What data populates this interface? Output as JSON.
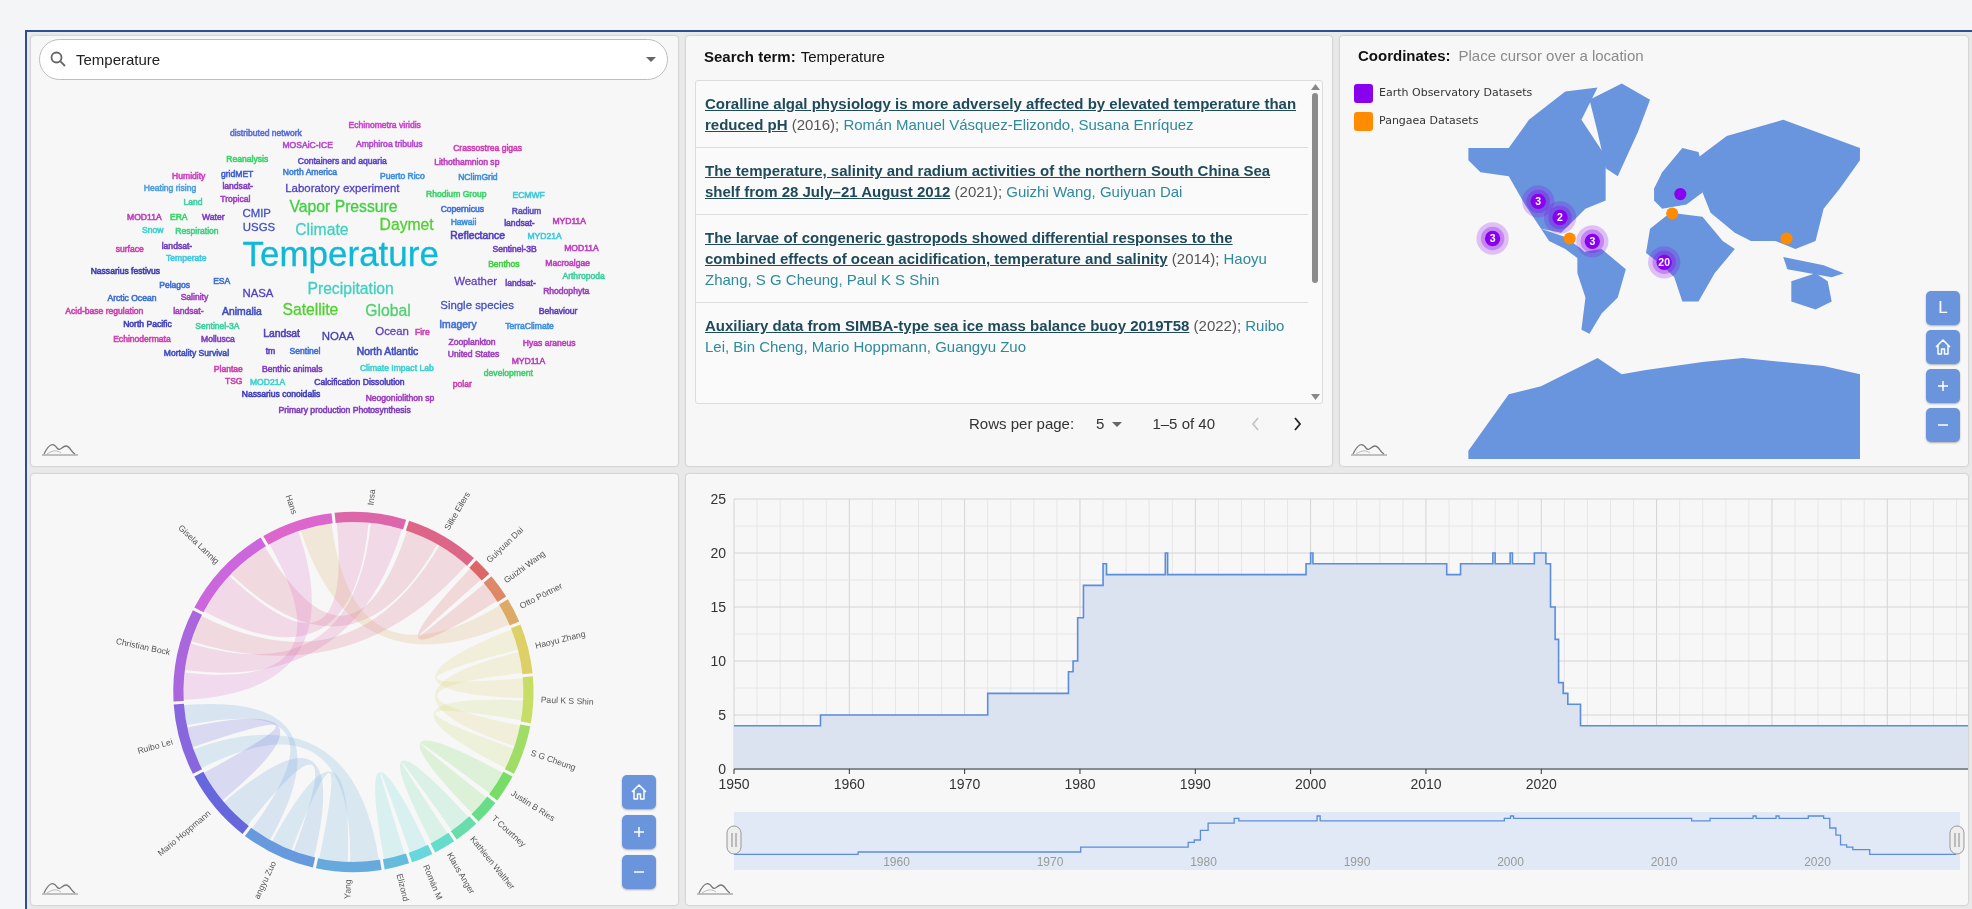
{
  "word_cloud_panel": {
    "search": {
      "value": "Temperature"
    },
    "words": [
      {
        "text": "Echinometra viridis",
        "color": "#cc44cc"
      },
      {
        "text": "distributed network",
        "color": "#5b6fd6"
      },
      {
        "text": "MOSAiC-ICE",
        "color": "#b44ad0"
      },
      {
        "text": "Amphiroa tribulus",
        "color": "#b44ad0"
      },
      {
        "text": "Crassostrea gigas",
        "color": "#d040b0"
      },
      {
        "text": "Reanalysis",
        "color": "#3bd36a"
      },
      {
        "text": "Containers and aquaria",
        "color": "#6048c8"
      },
      {
        "text": "Lithothamnion sp",
        "color": "#c040c0"
      },
      {
        "text": "Humidity",
        "color": "#d040c0"
      },
      {
        "text": "gridMET",
        "color": "#4060d0"
      },
      {
        "text": "North America",
        "color": "#3f7fd8"
      },
      {
        "text": "Puerto Rico",
        "color": "#3f8fe0"
      },
      {
        "text": "NClimGrid",
        "color": "#3f8fe0"
      },
      {
        "text": "Heating rising",
        "color": "#4f9fe0"
      },
      {
        "text": "landsat-",
        "color": "#8040c0"
      },
      {
        "text": "Laboratory experiment",
        "color": "#5040c0"
      },
      {
        "text": "Rhodium Group",
        "color": "#3bd36a"
      },
      {
        "text": "ECMWF",
        "color": "#40c8d8"
      },
      {
        "text": "Land",
        "color": "#40d0a0"
      },
      {
        "text": "Tropical",
        "color": "#a040c0"
      },
      {
        "text": "Vapor Pressure",
        "color": "#40d040"
      },
      {
        "text": "Copernicus",
        "color": "#4070d8"
      },
      {
        "text": "Radium",
        "color": "#6050c0"
      },
      {
        "text": "MOD11A",
        "color": "#c040c0"
      },
      {
        "text": "ERA",
        "color": "#3bd36a"
      },
      {
        "text": "Water",
        "color": "#8040c0"
      },
      {
        "text": "CMIP",
        "color": "#4050c0"
      },
      {
        "text": "Hawaii",
        "color": "#4090e0"
      },
      {
        "text": "landsat-",
        "color": "#6040c0"
      },
      {
        "text": "MYD11A",
        "color": "#c040c0"
      },
      {
        "text": "Snow",
        "color": "#40d0d0"
      },
      {
        "text": "Respiration",
        "color": "#40d080"
      },
      {
        "text": "USGS",
        "color": "#4050c0"
      },
      {
        "text": "Climate",
        "color": "#40d0c0"
      },
      {
        "text": "Daymet",
        "color": "#50d030"
      },
      {
        "text": "Reflectance",
        "color": "#5040c0"
      },
      {
        "text": "MYD21A",
        "color": "#40c8e0"
      },
      {
        "text": "surface",
        "color": "#d040b0"
      },
      {
        "text": "landsat-",
        "color": "#7040c0"
      },
      {
        "text": "Temperate",
        "color": "#40c8e0"
      },
      {
        "text": "Temperature",
        "color": "#10b8d8"
      },
      {
        "text": "Sentinel-3B",
        "color": "#7040c0"
      },
      {
        "text": "MOD11A",
        "color": "#c040c0"
      },
      {
        "text": "Benthos",
        "color": "#40d040"
      },
      {
        "text": "Macroalgae",
        "color": "#c040c0"
      },
      {
        "text": "Nassarius festivus",
        "color": "#4040b0"
      },
      {
        "text": "Arthropoda",
        "color": "#40d0a0"
      },
      {
        "text": "Arctic Ocean",
        "color": "#4070d0"
      },
      {
        "text": "Pelagos",
        "color": "#4070d8"
      },
      {
        "text": "Salinity",
        "color": "#a040c0"
      },
      {
        "text": "ESA",
        "color": "#4070d8"
      },
      {
        "text": "NASA",
        "color": "#5040c0"
      },
      {
        "text": "Precipitation",
        "color": "#40d0c0"
      },
      {
        "text": "Weather",
        "color": "#6040c0"
      },
      {
        "text": "landsat-",
        "color": "#7040c0"
      },
      {
        "text": "Rhodophyta",
        "color": "#a040c0"
      },
      {
        "text": "Acid-base regulation",
        "color": "#d040b0"
      },
      {
        "text": "landsat-",
        "color": "#a040c0"
      },
      {
        "text": "Animalia",
        "color": "#4050c0"
      },
      {
        "text": "Satellite",
        "color": "#50d030"
      },
      {
        "text": "Global",
        "color": "#50d070"
      },
      {
        "text": "Single species",
        "color": "#4050c0"
      },
      {
        "text": "Behaviour",
        "color": "#6040c0"
      },
      {
        "text": "North Pacific",
        "color": "#4040c0"
      },
      {
        "text": "Sentinel-3A",
        "color": "#40d0a0"
      },
      {
        "text": "Landsat",
        "color": "#5040c0"
      },
      {
        "text": "NOAA",
        "color": "#4040b0"
      },
      {
        "text": "Ocean",
        "color": "#6040c0"
      },
      {
        "text": "Fire",
        "color": "#d040b0"
      },
      {
        "text": "Imagery",
        "color": "#4070d8"
      },
      {
        "text": "TerraClimate",
        "color": "#4090e0"
      },
      {
        "text": "Echinodermata",
        "color": "#d040b0"
      },
      {
        "text": "Mollusca",
        "color": "#8040c0"
      },
      {
        "text": "Zooplankton",
        "color": "#a040c0"
      },
      {
        "text": "Hyas araneus",
        "color": "#c040c0"
      },
      {
        "text": "Mortality Survival",
        "color": "#4050c0"
      },
      {
        "text": "tm",
        "color": "#6040c0"
      },
      {
        "text": "Sentinel",
        "color": "#4070d8"
      },
      {
        "text": "North Atlantic",
        "color": "#4050c0"
      },
      {
        "text": "United States",
        "color": "#a040c0"
      },
      {
        "text": "MYD11A",
        "color": "#c040c0"
      },
      {
        "text": "Plantae",
        "color": "#d040b0"
      },
      {
        "text": "Benthic animals",
        "color": "#8040c0"
      },
      {
        "text": "Climate Impact Lab",
        "color": "#40d0d0"
      },
      {
        "text": "development",
        "color": "#40d070"
      },
      {
        "text": "TSG",
        "color": "#d040b0"
      },
      {
        "text": "MOD21A",
        "color": "#40d0d0"
      },
      {
        "text": "Calcification Dissolution",
        "color": "#5040c0"
      },
      {
        "text": "polar",
        "color": "#d040b0"
      },
      {
        "text": "Nassarius conoidalis",
        "color": "#4040c0"
      },
      {
        "text": "Neogoniolithon sp",
        "color": "#a040c0"
      },
      {
        "text": "Primary production Photosynthesis",
        "color": "#8040c0"
      }
    ]
  },
  "results_panel": {
    "label": "Search term:",
    "term": "Temperature",
    "results": [
      {
        "title": "Coralline algal physiology is more adversely affected by elevated temperature than reduced pH",
        "year": "(2016);",
        "authors": "Román Manuel Vásquez-Elizondo, Susana Enríquez"
      },
      {
        "title": "The temperature, salinity and radium activities of the northern South China Sea shelf from 28 July–21 August 2012",
        "year": "(2021);",
        "authors": "Guizhi Wang, Guiyuan Dai"
      },
      {
        "title": "The larvae of congeneric gastropods showed differential responses to the combined effects of ocean acidification, temperature and salinity",
        "year": "(2014);",
        "authors": "Haoyu Zhang, S G Cheung, Paul K S Shin"
      },
      {
        "title": "Auxiliary data from SIMBA-type sea ice mass balance buoy 2019T58",
        "year": "(2022);",
        "authors": "Ruibo Lei, Bin Cheng, Mario Hoppmann, Guangyu Zuo"
      }
    ],
    "pagination": {
      "rows_label": "Rows per page:",
      "rows_value": "5",
      "range": "1–5 of 40",
      "prev_disabled": true,
      "next_disabled": false
    }
  },
  "map_panel": {
    "label": "Coordinates:",
    "value": "Place cursor over a location",
    "legend": [
      {
        "label": "Earth Observatory Datasets",
        "color": "#8800ee"
      },
      {
        "label": "Pangaea Datasets",
        "color": "#ff8c00"
      }
    ],
    "markers": [
      {
        "kind": "cluster",
        "label": "3",
        "color": "#8800ee"
      },
      {
        "kind": "cluster",
        "label": "2",
        "color": "#8800ee"
      },
      {
        "kind": "cluster",
        "label": "3",
        "color": "#8800ee"
      },
      {
        "kind": "cluster",
        "label": "3",
        "color": "#8800ee"
      },
      {
        "kind": "cluster",
        "label": "20",
        "color": "#8800ee"
      },
      {
        "kind": "point",
        "color": "#8800ee"
      },
      {
        "kind": "point",
        "color": "#ff8c00"
      },
      {
        "kind": "point",
        "color": "#ff8c00"
      },
      {
        "kind": "point",
        "color": "#ff8c00"
      }
    ],
    "buttons": [
      {
        "kind": "label",
        "label": "L"
      },
      {
        "kind": "home"
      },
      {
        "kind": "plus"
      },
      {
        "kind": "minus"
      }
    ]
  },
  "chord_panel": {
    "nodes": [
      {
        "label": "Hans",
        "color": "#dd66cc"
      },
      {
        "label": "Insa",
        "color": "#dd66aa"
      },
      {
        "label": "Silke Eilers",
        "color": "#dd6688"
      },
      {
        "label": "Guiyuan Dai",
        "color": "#dd6666"
      },
      {
        "label": "Guizhi Wang",
        "color": "#dd8866"
      },
      {
        "label": "Otto Pörtner",
        "color": "#ddaa66"
      },
      {
        "label": "Haoyu Zhang",
        "color": "#ddd066"
      },
      {
        "label": "Paul K S Shin",
        "color": "#c8dd66"
      },
      {
        "label": "S G Cheung",
        "color": "#a0dd66"
      },
      {
        "label": "Justin B Ries",
        "color": "#77dd66"
      },
      {
        "label": "T Courtney",
        "color": "#66dd88"
      },
      {
        "label": "Kathleen Walther",
        "color": "#66ddaa"
      },
      {
        "label": "Klaus Anger",
        "color": "#66ddcc"
      },
      {
        "label": "Román M",
        "color": "#66d8dd"
      },
      {
        "label": "Elizond",
        "color": "#66bbdd"
      },
      {
        "label": "Yang",
        "color": "#66aadd"
      },
      {
        "label": "angyu Zuo",
        "color": "#6699dd"
      },
      {
        "label": "Mario Hoppmann",
        "color": "#6666dd"
      },
      {
        "label": "Ruibo Lei",
        "color": "#8866dd"
      },
      {
        "label": "Christian Bock",
        "color": "#aa66dd"
      },
      {
        "label": "Gisela Lannig",
        "color": "#cc66dd"
      }
    ],
    "buttons": [
      {
        "kind": "home"
      },
      {
        "kind": "plus"
      },
      {
        "kind": "minus"
      }
    ]
  },
  "chart_panel": {
    "chart_data": {
      "type": "area",
      "grid": true,
      "x": [
        1950,
        1957.5,
        1957.5,
        1972,
        1972,
        1979,
        1979,
        1979.4,
        1979.4,
        1979.8,
        1979.8,
        1980.3,
        1980.3,
        1982,
        1982,
        1982.3,
        1982.3,
        1987.4,
        1987.4,
        1987.6,
        1987.6,
        1999.6,
        1999.6,
        2000,
        2000,
        2000.2,
        2000.2,
        2011.8,
        2011.8,
        2013,
        2013,
        2015.8,
        2015.8,
        2016,
        2016,
        2017.3,
        2017.3,
        2017.5,
        2017.5,
        2019.4,
        2019.4,
        2020.4,
        2020.4,
        2020.8,
        2020.8,
        2021.2,
        2021.2,
        2021.5,
        2021.5,
        2021.9,
        2021.9,
        2022.3,
        2022.3,
        2023.4,
        2023.4,
        2057
      ],
      "values": [
        4,
        4,
        5,
        5,
        7,
        7,
        9,
        9,
        10,
        10,
        14,
        14,
        17,
        17,
        19,
        19,
        18,
        18,
        20,
        20,
        18,
        18,
        19,
        19,
        20,
        20,
        19,
        19,
        18,
        18,
        19,
        19,
        20,
        20,
        19,
        19,
        20,
        20,
        19,
        19,
        20,
        20,
        19,
        19,
        15,
        15,
        12,
        12,
        8,
        8,
        7,
        7,
        6,
        6,
        4,
        4
      ],
      "xlim": [
        1950,
        2057
      ],
      "ylim": [
        0,
        25
      ],
      "xticks": [
        1950,
        1960,
        1970,
        1980,
        1990,
        2000,
        2010,
        2020
      ],
      "yticks": [
        0,
        5,
        10,
        15,
        20,
        25
      ]
    },
    "navigator": {
      "labels": [
        "1960",
        "1970",
        "1980",
        "1990",
        "2000",
        "2010",
        "2020"
      ]
    }
  }
}
